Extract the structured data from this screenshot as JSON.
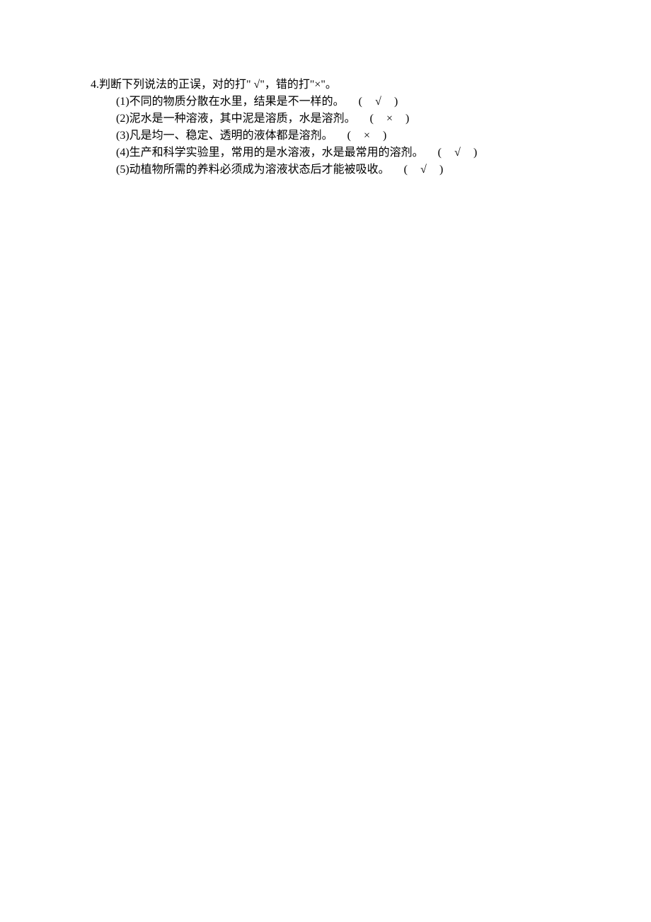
{
  "question": {
    "number": "4.",
    "prompt": "判断下列说法的正误，对的打\" √\"，错的打\"×\"。"
  },
  "items": [
    {
      "label": "(1)",
      "text": "不同的物质分散在水里，结果是不一样的。",
      "answer": "√"
    },
    {
      "label": "(2)",
      "text": "泥水是一种溶液，其中泥是溶质，水是溶剂。",
      "answer": "×"
    },
    {
      "label": "(3)",
      "text": "凡是均一、稳定、透明的液体都是溶剂。",
      "answer": "×"
    },
    {
      "label": "(4)",
      "text": "生产和科学实验里，常用的是水溶液，水是最常用的溶剂。",
      "answer": "√"
    },
    {
      "label": "(5)",
      "text": "动植物所需的养料必须成为溶液状态后才能被吸收。",
      "answer": "√"
    }
  ],
  "paren": {
    "open": "(",
    "close": ")"
  }
}
